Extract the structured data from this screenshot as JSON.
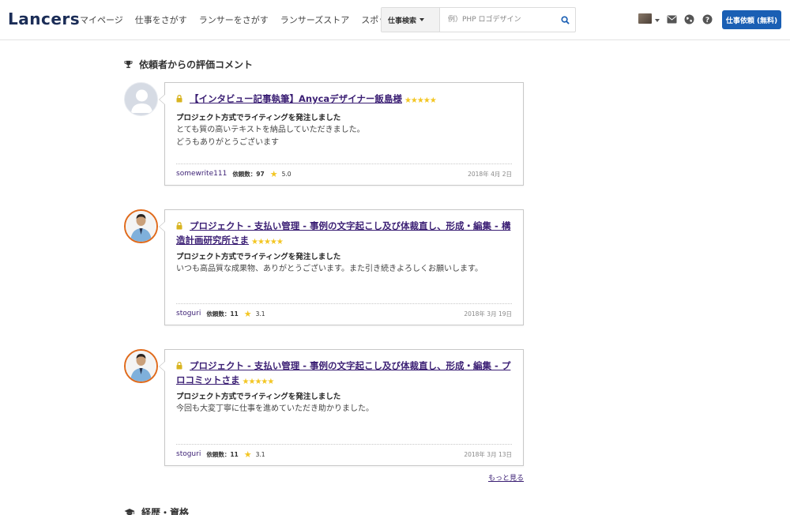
{
  "header": {
    "logo": "Lancers",
    "nav": [
      "マイページ",
      "仕事をさがす",
      "ランサーをさがす",
      "ランサーズストア",
      "スポット常駐"
    ],
    "search_select": "仕事検索",
    "search_placeholder": "例）PHP ロゴデザイン",
    "cta": "仕事依頼 (無料)"
  },
  "reviews_section": {
    "title": "依頼者からの評価コメント"
  },
  "reviews": [
    {
      "title": "【インタビュー記事執筆】Anycaデザイナー飯島様",
      "rating_stars": 5,
      "subtitle": "プロジェクト方式でライティングを発注しました",
      "comment_lines": [
        "とても質の高いテキストを納品していただきました。",
        "どうもありがとうございます"
      ],
      "user": "somewrite111",
      "count_label": "依頼数：97",
      "score": "5.0",
      "date": "2018年 4月 2日",
      "avatar": "default"
    },
    {
      "title": "プロジェクト - 支払い管理 - 事例の文字起こし及び体裁直し、形成・編集 - 構造計画研究所さま",
      "rating_stars": 5,
      "subtitle": "プロジェクト方式でライティングを発注しました",
      "comment_lines": [
        "いつも高品質な成果物、ありがとうございます。また引き続きよろしくお願いします。"
      ],
      "user": "stoguri",
      "count_label": "依頼数：11",
      "score": "3.1",
      "date": "2018年 3月 19日",
      "avatar": "photo"
    },
    {
      "title": "プロジェクト - 支払い管理 - 事例の文字起こし及び体裁直し、形成・編集 - プロコミットさま",
      "rating_stars": 5,
      "subtitle": "プロジェクト方式でライティングを発注しました",
      "comment_lines": [
        "今回も大変丁寧に仕事を進めていただき助かりました。"
      ],
      "user": "stoguri",
      "count_label": "依頼数：11",
      "score": "3.1",
      "date": "2018年 3月 13日",
      "avatar": "photo"
    }
  ],
  "more_link": "もっと見る",
  "career_section": {
    "title": "経歴・資格"
  },
  "icons": {
    "trophy": "trophy-icon",
    "graduation": "graduation-cap-icon",
    "lock": "lock-icon",
    "star": "star-icon",
    "search": "search-icon",
    "mail": "mail-icon",
    "globe": "globe-icon",
    "help": "help-icon"
  },
  "colors": {
    "brand_navy": "#1b2d57",
    "cta_blue": "#1a5fb4",
    "link_purple": "#3b1f74",
    "star_gold": "#f3c623",
    "avatar_ring": "#e06a1b",
    "lock_gold": "#d8b420"
  }
}
